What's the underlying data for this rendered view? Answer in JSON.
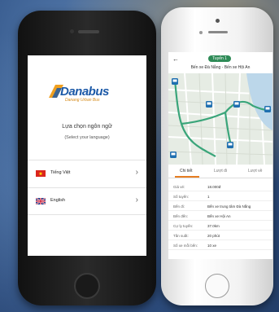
{
  "left_screen": {
    "logo": {
      "brand": "Danabus",
      "tagline": "Danang Urban Bus"
    },
    "prompt": "Lựa chọn ngôn ngữ",
    "prompt_sub": "(Select your language)",
    "languages": [
      {
        "label": "Tiếng Việt",
        "flag": "vietnam-flag-icon"
      },
      {
        "label": "English",
        "flag": "uk-flag-icon"
      }
    ],
    "chevron": "›"
  },
  "right_screen": {
    "back": "←",
    "route_badge": "Tuyến 1",
    "route_title": "Bến xe Đà Nẵng - Bến xe Hội An",
    "tabs": [
      "Chi tiết",
      "Lượt đi",
      "Lượt về"
    ],
    "details": [
      {
        "key": "Giá vé:",
        "value": "18.000đ"
      },
      {
        "key": "Số tuyến:",
        "value": "1"
      },
      {
        "key": "Bến đi:",
        "value": "Bến xe trung tâm Đà Nẵng"
      },
      {
        "key": "Bến đến:",
        "value": "Bến xe Hội An"
      },
      {
        "key": "Cự ly tuyến:",
        "value": "37.0km"
      },
      {
        "key": "Tần suất:",
        "value": "20 phút"
      },
      {
        "key": "Số xe mỗi bến:",
        "value": "10 xe"
      }
    ],
    "colors": {
      "route": "#3aa57a",
      "badge": "#2e8b57",
      "tab_underline": "#e67e22"
    }
  }
}
